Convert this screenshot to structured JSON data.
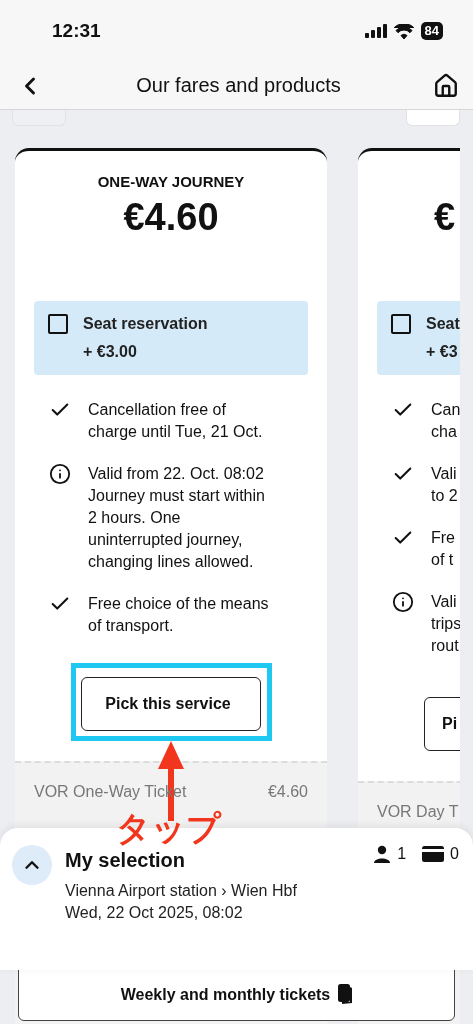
{
  "status_bar": {
    "time": "12:31",
    "battery": "84"
  },
  "header": {
    "title": "Our fares and products"
  },
  "cards": [
    {
      "kind": "full",
      "title": "ONE-WAY JOURNEY",
      "price": "€4.60",
      "seat": {
        "label": "Seat reservation",
        "price": "+ €3.00",
        "checked": false
      },
      "features": [
        {
          "kind": "check",
          "lines": [
            "Cancellation free of",
            "charge until Tue, 21 Oct."
          ]
        },
        {
          "kind": "info",
          "lines": [
            "Valid from 22. Oct. 08:02",
            "Journey must start within",
            "2 hours. One",
            "uninterrupted journey,",
            "changing lines allowed."
          ]
        },
        {
          "kind": "check",
          "lines": [
            "Free choice of the means",
            "of transport."
          ]
        }
      ],
      "button": "Pick this service",
      "footer": {
        "label": "VOR One-Way Ticket",
        "price": "€4.60"
      }
    },
    {
      "kind": "clipped",
      "price": "€",
      "seat": {
        "label": "Seat",
        "price": "+ €3",
        "checked": false
      },
      "features": [
        {
          "kind": "check",
          "lines": [
            "Can",
            "cha"
          ]
        },
        {
          "kind": "check",
          "lines": [
            "Vali",
            "to 2"
          ]
        },
        {
          "kind": "check",
          "lines": [
            "Fre",
            "of t"
          ]
        },
        {
          "kind": "info",
          "lines": [
            "Vali",
            "trips",
            "rout"
          ]
        }
      ],
      "button": "Pi",
      "footer": {
        "label": "VOR Day T"
      }
    }
  ],
  "annotation": {
    "label": "タップ"
  },
  "selection": {
    "title": "My selection",
    "route": "Vienna Airport station › Wien Hbf",
    "date": "Wed, 22 Oct 2025, 08:02",
    "passengers": "1",
    "discount_cards": "0",
    "expanded": false
  },
  "bottom_button": {
    "label": "Weekly and monthly tickets"
  }
}
